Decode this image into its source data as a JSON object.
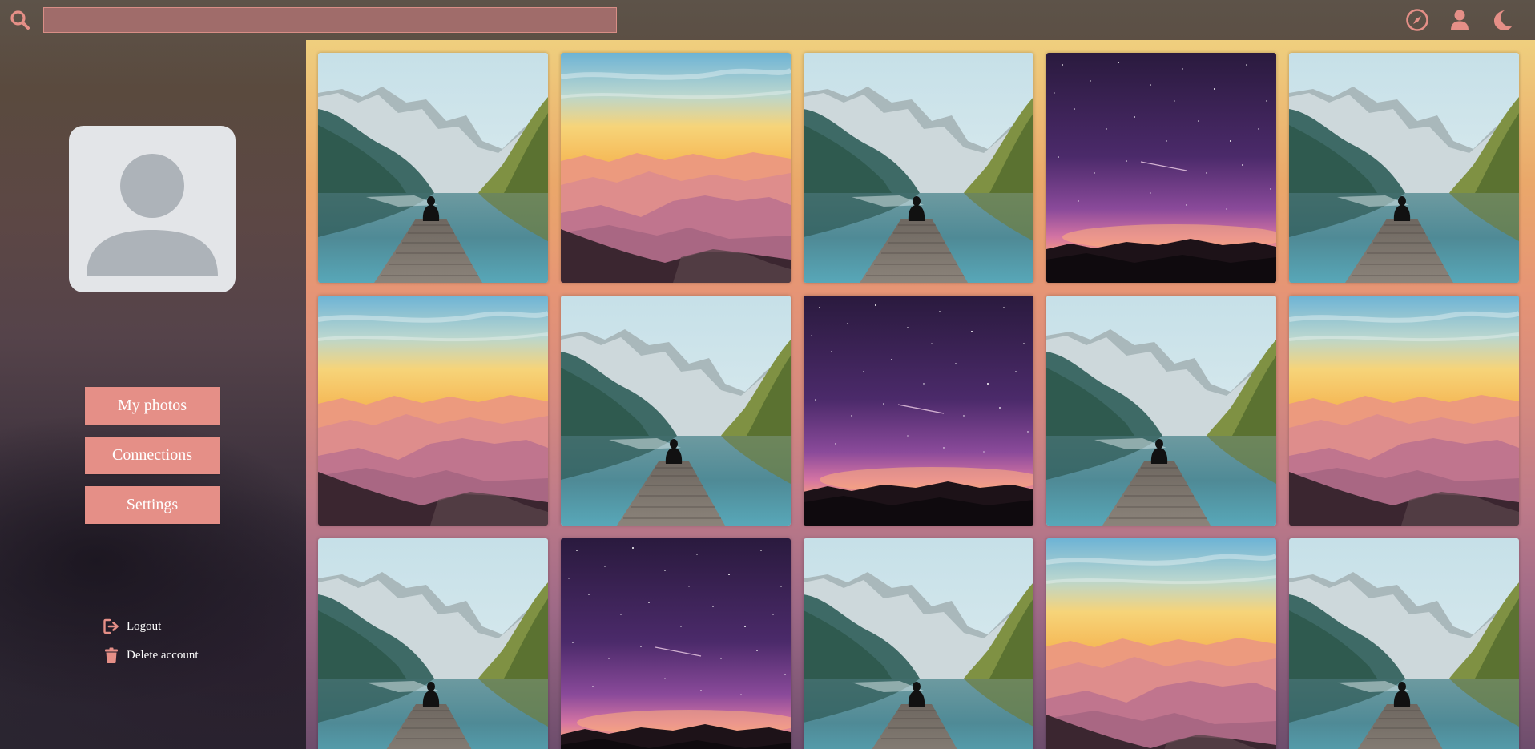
{
  "search": {
    "placeholder": "",
    "value": ""
  },
  "topbar": {
    "icons": [
      "search-icon",
      "compass-icon",
      "user-icon",
      "moon-icon"
    ]
  },
  "sidebar": {
    "avatar": "default-avatar",
    "buttons": [
      {
        "label": "My photos"
      },
      {
        "label": "Connections"
      },
      {
        "label": "Settings"
      }
    ],
    "links": [
      {
        "label": "Logout",
        "icon": "logout-icon"
      },
      {
        "label": "Delete account",
        "icon": "trash-icon"
      }
    ]
  },
  "gallery": {
    "photos": [
      "lake-pier",
      "sunset-mountains",
      "lake-pier",
      "starry-night",
      "lake-pier",
      "sunset-mountains",
      "lake-pier",
      "starry-night",
      "lake-pier",
      "sunset-mountains",
      "lake-pier",
      "starry-night",
      "lake-pier",
      "sunset-mountains",
      "lake-pier"
    ]
  },
  "colors": {
    "accent": "#e58f87",
    "search_bg": "#a06c6a",
    "icon": "#e58f87",
    "avatar_bg": "#e3e5e8"
  }
}
